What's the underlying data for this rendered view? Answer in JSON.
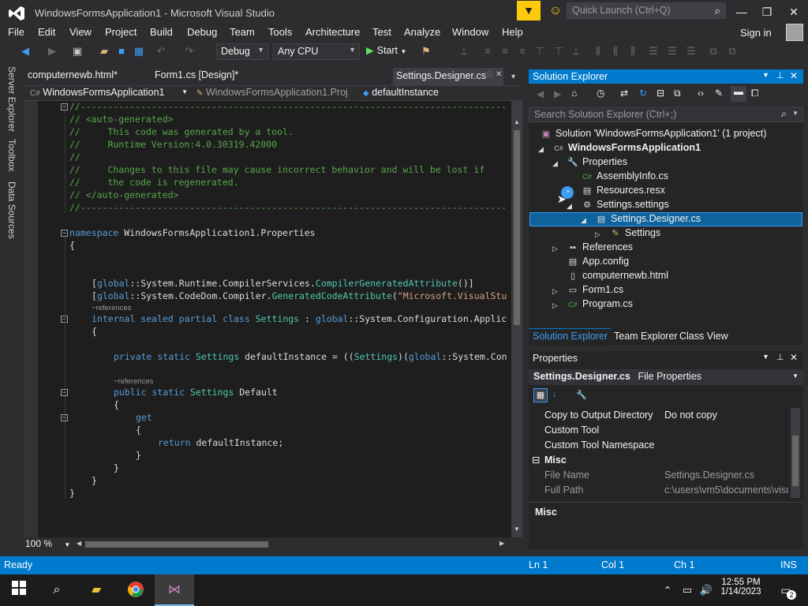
{
  "window": {
    "title": "WindowsFormsApplication1 - Microsoft Visual Studio",
    "quick_launch_placeholder": "Quick Launch (Ctrl+Q)"
  },
  "menu": [
    "File",
    "Edit",
    "View",
    "Project",
    "Build",
    "Debug",
    "Team",
    "Tools",
    "Architecture",
    "Test",
    "Analyze",
    "Window",
    "Help"
  ],
  "signin": "Sign in",
  "toolbar": {
    "config": "Debug",
    "platform": "Any CPU",
    "start": "Start"
  },
  "side_tabs": [
    "Server Explorer",
    "Toolbox",
    "Data Sources"
  ],
  "doc_tabs": [
    "computernewb.html*",
    "Form1.cs [Design]*",
    "Settings.Designer.cs"
  ],
  "nav": {
    "project": "WindowsFormsApplication1",
    "class": "WindowsFormsApplication1.Proj",
    "member": "defaultInstance"
  },
  "code": {
    "l1": "//------------------------------------------------------------------------------",
    "l2": "// <auto-generated>",
    "l3": "//     This code was generated by a tool.",
    "l4": "//     Runtime Version:4.0.30319.42000",
    "l5": "//",
    "l6": "//     Changes to this file may cause incorrect behavior and will be lost if",
    "l7": "//     the code is regenerated.",
    "l8": "// </auto-generated>",
    "l9": "//------------------------------------------------------------------------------",
    "ns_kw": "namespace",
    "ns_name": " WindowsFormsApplication1.Properties",
    "brace_open": "{",
    "brace_close": "}",
    "attr1_a": "[",
    "attr1_b": "global",
    "attr1_c": "::System.Runtime.CompilerServices.",
    "attr1_d": "CompilerGeneratedAttribute",
    "attr1_e": "()]",
    "attr2_a": "[",
    "attr2_b": "global",
    "attr2_c": "::System.CodeDom.Compiler.",
    "attr2_d": "GeneratedCodeAttribute",
    "attr2_e": "(",
    "attr2_f": "\"Microsoft.VisualStu",
    "refs": "−references",
    "cls_kw": "internal sealed partial class",
    "cls_name": " Settings",
    "cls_rest_a": " : ",
    "cls_rest_b": "global",
    "cls_rest_c": "::System.Configuration.Applic",
    "field_kw": "private static",
    "field_type": " Settings",
    "field_rest_a": " defaultInstance = ((",
    "field_rest_b": "Settings",
    "field_rest_c": ")(",
    "field_rest_d": "global",
    "field_rest_e": "::System.Con",
    "prop_kw": "public static",
    "prop_type": " Settings",
    "prop_name": " Default",
    "get_kw": "get",
    "ret_kw": "return",
    "ret_rest": " defaultInstance;"
  },
  "zoom": "100 %",
  "solution_explorer": {
    "title": "Solution Explorer",
    "search_placeholder": "Search Solution Explorer (Ctrl+;)",
    "items": [
      {
        "label": "Solution 'WindowsFormsApplication1' (1 project)"
      },
      {
        "label": "WindowsFormsApplication1"
      },
      {
        "label": "Properties"
      },
      {
        "label": "AssemblyInfo.cs"
      },
      {
        "label": "Resources.resx"
      },
      {
        "label": "Settings.settings"
      },
      {
        "label": "Settings.Designer.cs"
      },
      {
        "label": "Settings"
      },
      {
        "label": "References"
      },
      {
        "label": "App.config"
      },
      {
        "label": "computernewb.html"
      },
      {
        "label": "Form1.cs"
      },
      {
        "label": "Program.cs"
      }
    ],
    "tabs": [
      "Solution Explorer",
      "Team Explorer",
      "Class View"
    ]
  },
  "properties": {
    "title": "Properties",
    "object_name": "Settings.Designer.cs",
    "object_type": "File Properties",
    "rows": [
      {
        "name": "Copy to Output Directory",
        "value": "Do not copy"
      },
      {
        "name": "Custom Tool",
        "value": ""
      },
      {
        "name": "Custom Tool Namespace",
        "value": ""
      }
    ],
    "category": "Misc",
    "misc_rows": [
      {
        "name": "File Name",
        "value": "Settings.Designer.cs"
      },
      {
        "name": "Full Path",
        "value": "c:\\users\\vm5\\documents\\visu"
      }
    ],
    "description": "Misc"
  },
  "status": {
    "state": "Ready",
    "line": "Ln 1",
    "col": "Col 1",
    "ch": "Ch 1",
    "mode": "INS"
  },
  "taskbar": {
    "time": "12:55 PM",
    "date": "1/14/2023",
    "notifications": "2"
  }
}
